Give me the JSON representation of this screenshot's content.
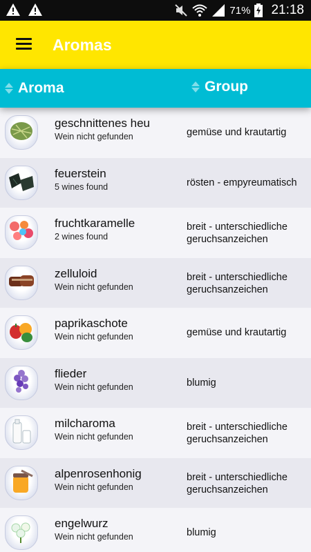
{
  "status_bar": {
    "battery": "71%",
    "time": "21:18",
    "icons": [
      "warning-icon",
      "warning-icon",
      "mute-icon",
      "wifi-icon",
      "signal-icon",
      "battery-charging-icon"
    ]
  },
  "app_bar": {
    "title": "Aromas",
    "menu_icon": "hamburger-menu-icon",
    "color": "#ffe600"
  },
  "header": {
    "aroma_label": "Aroma",
    "group_label": "Group",
    "color": "#00bcd4"
  },
  "rows": [
    {
      "name": "geschnittenes heu",
      "sub": "Wein nicht gefunden",
      "group": "gemüse und krautartig",
      "image": "hay"
    },
    {
      "name": "feuerstein",
      "sub": "5 wines found",
      "group": "rösten - empyreumatisch",
      "image": "flint"
    },
    {
      "name": "fruchtkaramelle",
      "sub": "2 wines found",
      "group": "breit - unterschiedliche geruchsanzeichen",
      "image": "candy"
    },
    {
      "name": "zelluloid",
      "sub": "Wein nicht gefunden",
      "group": "breit - unterschiedliche geruchsanzeichen",
      "image": "celluloid"
    },
    {
      "name": "paprikaschote",
      "sub": "Wein nicht gefunden",
      "group": "gemüse und krautartig",
      "image": "pepper"
    },
    {
      "name": "flieder",
      "sub": "Wein nicht gefunden",
      "group": "blumig",
      "image": "lilac"
    },
    {
      "name": "milcharoma",
      "sub": "Wein nicht gefunden",
      "group": "breit - unterschiedliche geruchsanzeichen",
      "image": "milk"
    },
    {
      "name": "alpenrosenhonig",
      "sub": "Wein nicht gefunden",
      "group": "breit - unterschiedliche geruchsanzeichen",
      "image": "honey"
    },
    {
      "name": "engelwurz",
      "sub": "Wein nicht gefunden",
      "group": "blumig",
      "image": "angelica"
    }
  ]
}
